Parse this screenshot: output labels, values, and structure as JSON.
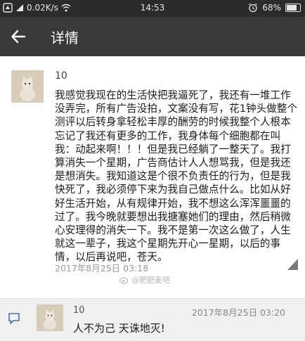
{
  "status_bar": {
    "network_speed": "0.02K/s",
    "time": "14:53",
    "battery": "68%",
    "battery_level": 0.68
  },
  "header": {
    "title": "详情"
  },
  "post": {
    "username": "10",
    "text": "我感觉我现在的生活快把我逼死了，我还有一堆工作\n没弄完，所有广告没拍，文案没有写，花1钟头做整个\n测评以后转身拿轻松丰厚的酬劳的时候我整个人根本\n忘记了我还有更多的工作，我身体每个细胞都在叫\n我：动起来啊！！！但是我已经躺了一整天了。我打\n算消失一个星期，广告商估计人人想骂我，但是我还\n是想消失。我知道这是个很不负责任的行为，但是我\n快死了，我必须停下来为我自己做点什么。比如从好\n好生活开始，从有规律开始，我不想这么浑浑噩噩的\n过了。我今晚就要想出我搪塞她们的理由，然后稍微\n心安理得的消失一下。我不是第一次这么做了，人生\n就这一辈子，我这个星期先开心一星期，以后的事\n情，以后再说吧，苍天。",
    "timestamp": "2017年8月25日 03:18",
    "watermark": "@肥肥麦吧"
  },
  "comment": {
    "username": "10",
    "timestamp": "2017年8月25日 03:20",
    "text": "人不为己 天诛地灭!"
  }
}
